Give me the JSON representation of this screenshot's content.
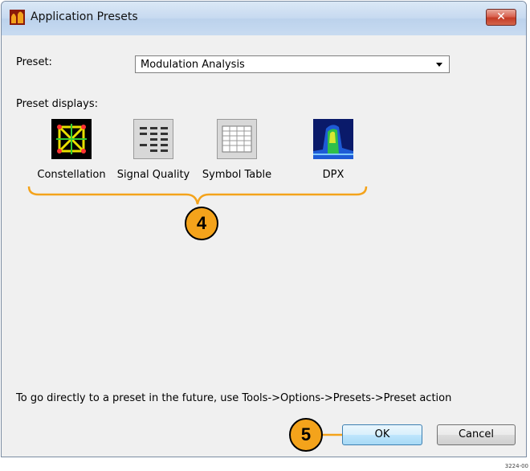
{
  "window": {
    "title": "Application Presets",
    "close_glyph": "✕",
    "icon": "tektronix-app-icon"
  },
  "preset": {
    "label": "Preset:",
    "selected": "Modulation Analysis"
  },
  "displays": {
    "label": "Preset displays:",
    "items": [
      {
        "label": "Constellation",
        "icon": "constellation-icon"
      },
      {
        "label": "Signal Quality",
        "icon": "signal-quality-icon"
      },
      {
        "label": "Symbol Table",
        "icon": "symbol-table-icon"
      },
      {
        "label": "DPX",
        "icon": "dpx-icon"
      }
    ]
  },
  "hint": "To go directly to a preset in the future, use Tools->Options->Presets->Preset action",
  "buttons": {
    "ok": "OK",
    "cancel": "Cancel"
  },
  "callouts": {
    "displays": "4",
    "ok": "5"
  },
  "colors": {
    "callout": "#f4a31b",
    "titlebar": "#c7daf0",
    "close": "#c43b25"
  },
  "figure_number": "3224-00"
}
